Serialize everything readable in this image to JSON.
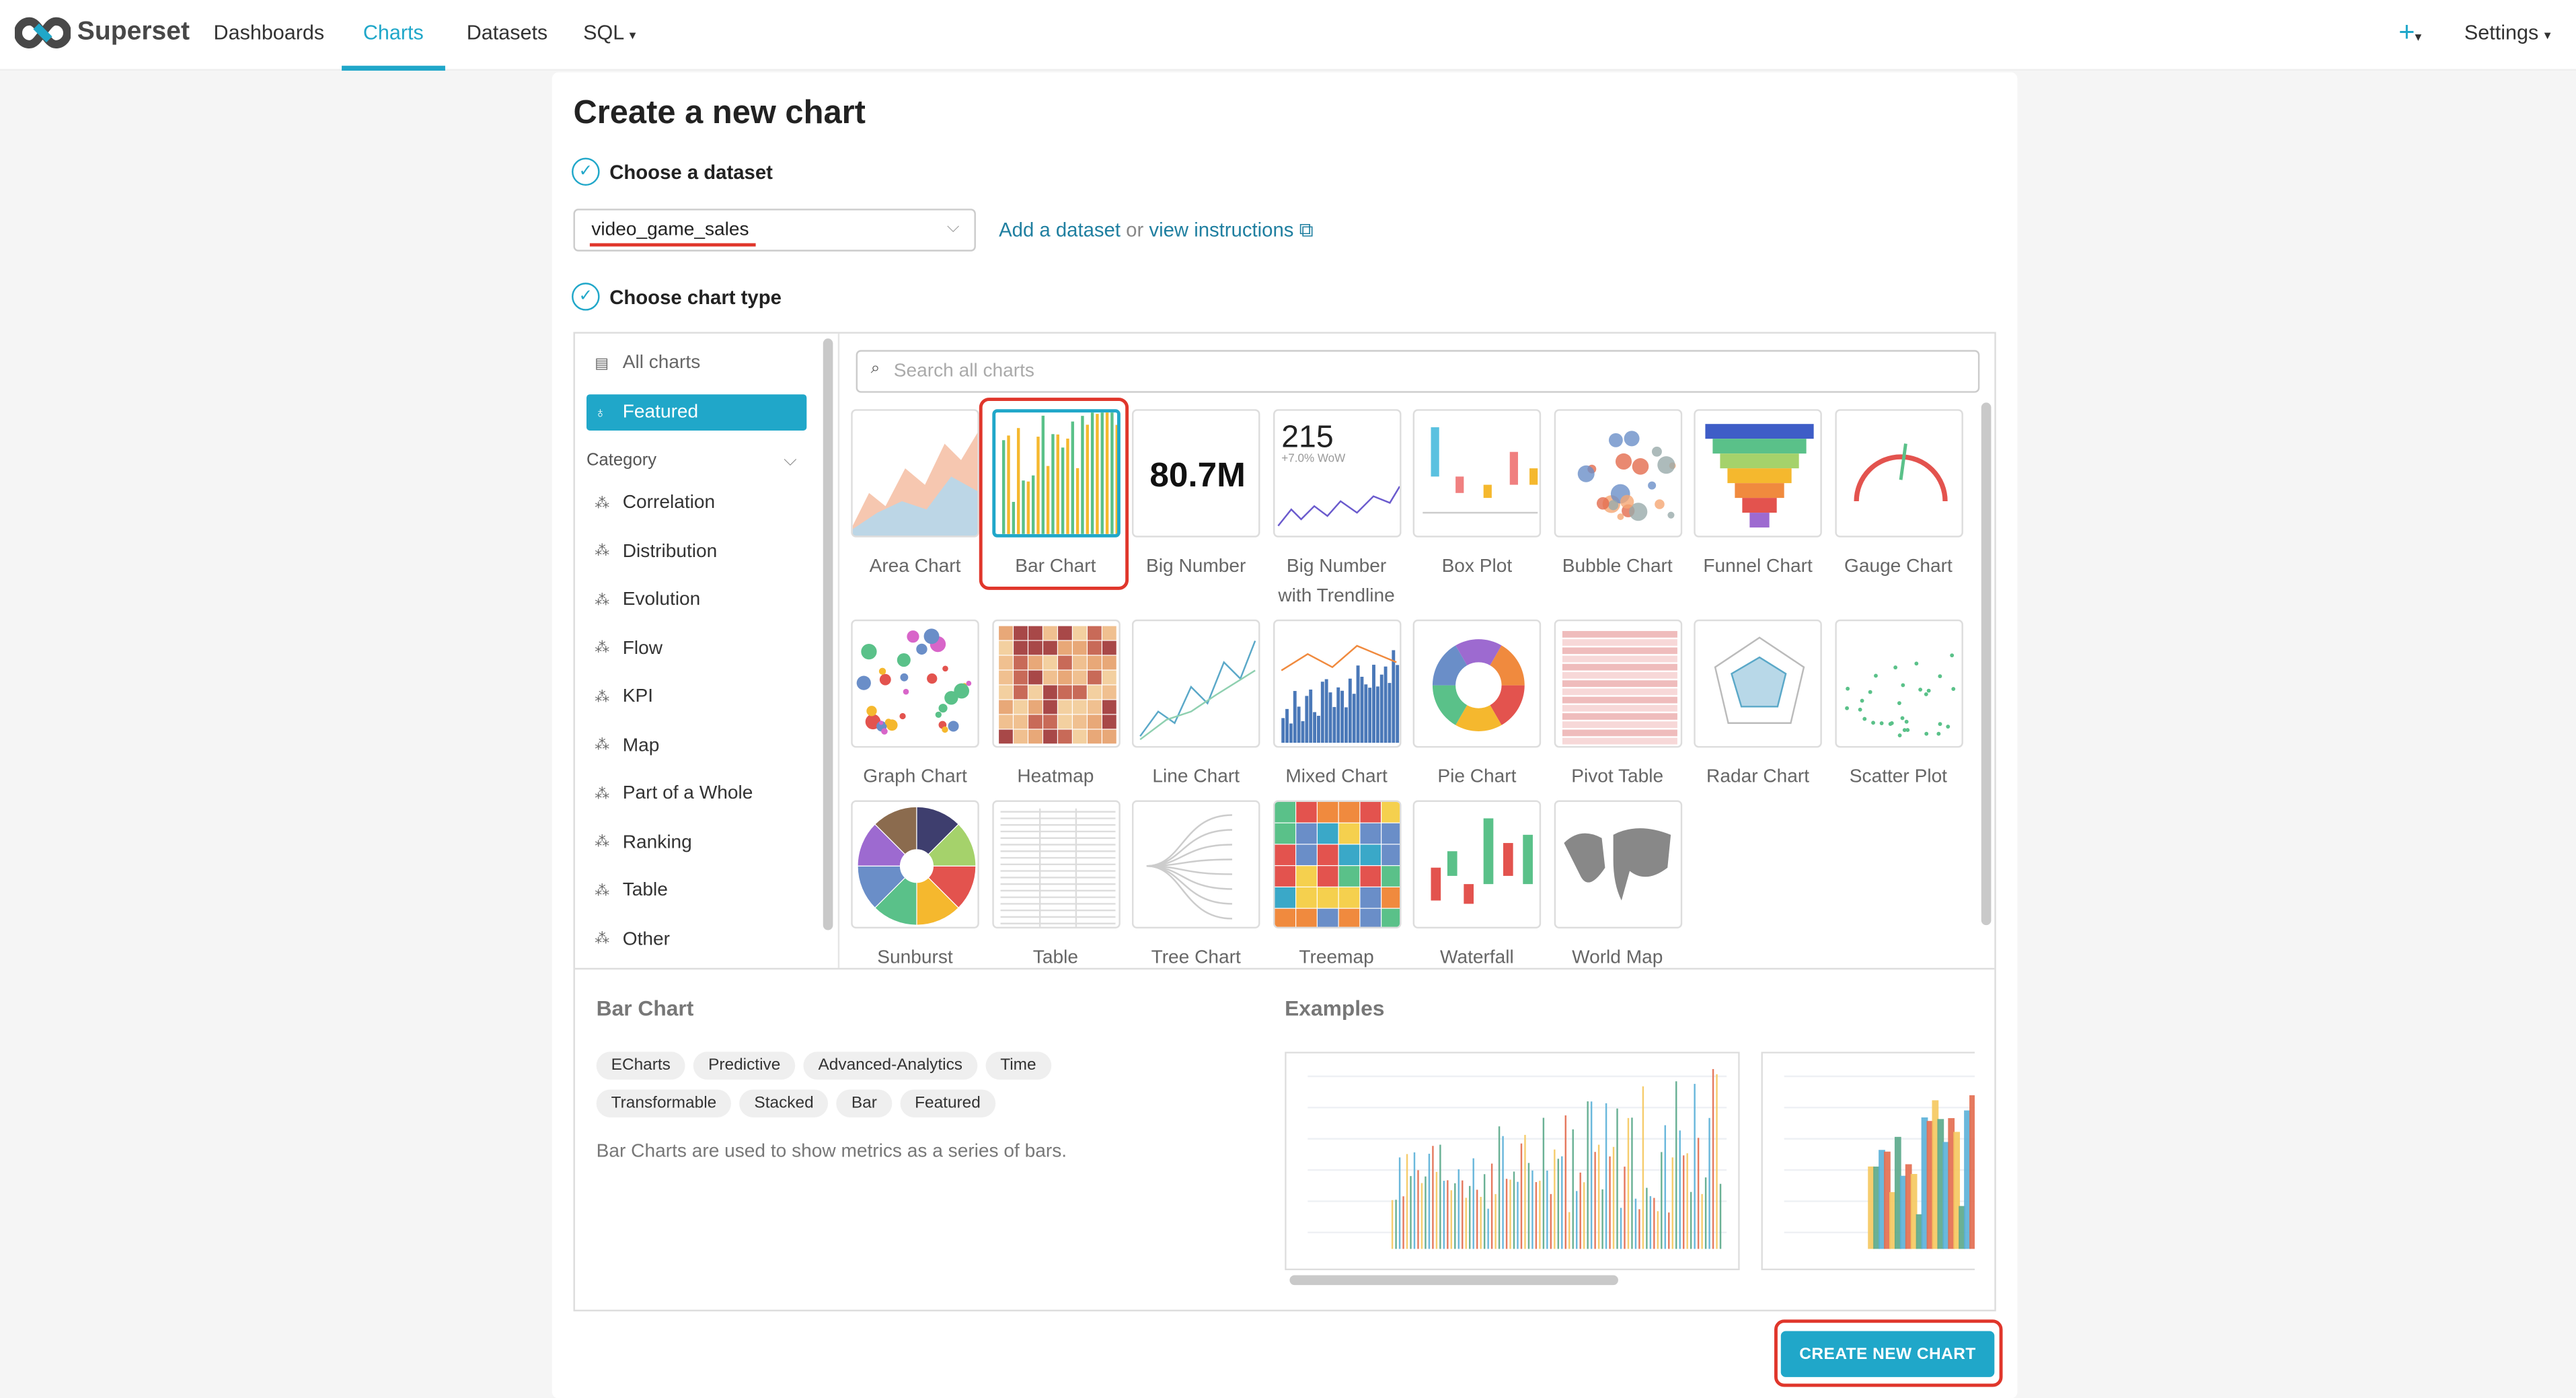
{
  "nav": {
    "brand": "Superset",
    "links": [
      "Dashboards",
      "Charts",
      "Datasets",
      "SQL"
    ],
    "active": "Charts",
    "sql_caret": "▾",
    "plus": "+",
    "plus_caret": "▾",
    "settings": "Settings",
    "settings_caret": "▾"
  },
  "page": {
    "title": "Create a new chart"
  },
  "step1": {
    "label": "Choose a dataset",
    "dataset_value": "video_game_sales",
    "add_link": "Add a dataset",
    "or": "or",
    "instructions_link": "view instructions"
  },
  "step2": {
    "label": "Choose chart type"
  },
  "sidebar": {
    "all": "All charts",
    "featured": "Featured",
    "category": "Category",
    "items": [
      "Correlation",
      "Distribution",
      "Evolution",
      "Flow",
      "KPI",
      "Map",
      "Part of a Whole",
      "Ranking",
      "Table",
      "Other"
    ]
  },
  "search": {
    "placeholder": "Search all charts"
  },
  "charts": [
    {
      "label": "Area Chart",
      "thumb": "area"
    },
    {
      "label": "Bar Chart",
      "thumb": "bar",
      "selected": true
    },
    {
      "label": "Big Number",
      "thumb": "bignum",
      "value": "80.7M"
    },
    {
      "label": "Big Number with Trendline",
      "thumb": "trend",
      "value": "215",
      "sub": "+7.0% WoW"
    },
    {
      "label": "Box Plot",
      "thumb": "box"
    },
    {
      "label": "Bubble Chart",
      "thumb": "bubble"
    },
    {
      "label": "Funnel Chart",
      "thumb": "funnel"
    },
    {
      "label": "Gauge Chart",
      "thumb": "gauge"
    },
    {
      "label": "Graph Chart",
      "thumb": "graph"
    },
    {
      "label": "Heatmap",
      "thumb": "heatmap"
    },
    {
      "label": "Line Chart",
      "thumb": "line"
    },
    {
      "label": "Mixed Chart",
      "thumb": "mixed"
    },
    {
      "label": "Pie Chart",
      "thumb": "pie"
    },
    {
      "label": "Pivot Table",
      "thumb": "pivot"
    },
    {
      "label": "Radar Chart",
      "thumb": "radar"
    },
    {
      "label": "Scatter Plot",
      "thumb": "scatter"
    },
    {
      "label": "Sunburst",
      "thumb": "sunburst"
    },
    {
      "label": "Table",
      "thumb": "table"
    },
    {
      "label": "Tree Chart",
      "thumb": "tree"
    },
    {
      "label": "Treemap",
      "thumb": "treemap"
    },
    {
      "label": "Waterfall",
      "thumb": "waterfall"
    },
    {
      "label": "World Map",
      "thumb": "world"
    }
  ],
  "details": {
    "title": "Bar Chart",
    "tags": [
      "ECharts",
      "Predictive",
      "Advanced-Analytics",
      "Time",
      "Transformable",
      "Stacked",
      "Bar",
      "Featured"
    ],
    "description": "Bar Charts are used to show metrics as a series of bars.",
    "examples_title": "Examples"
  },
  "footer": {
    "create_button": "CREATE NEW CHART"
  },
  "colors": {
    "accent": "#20a7c9",
    "highlight": "#e0362b"
  }
}
